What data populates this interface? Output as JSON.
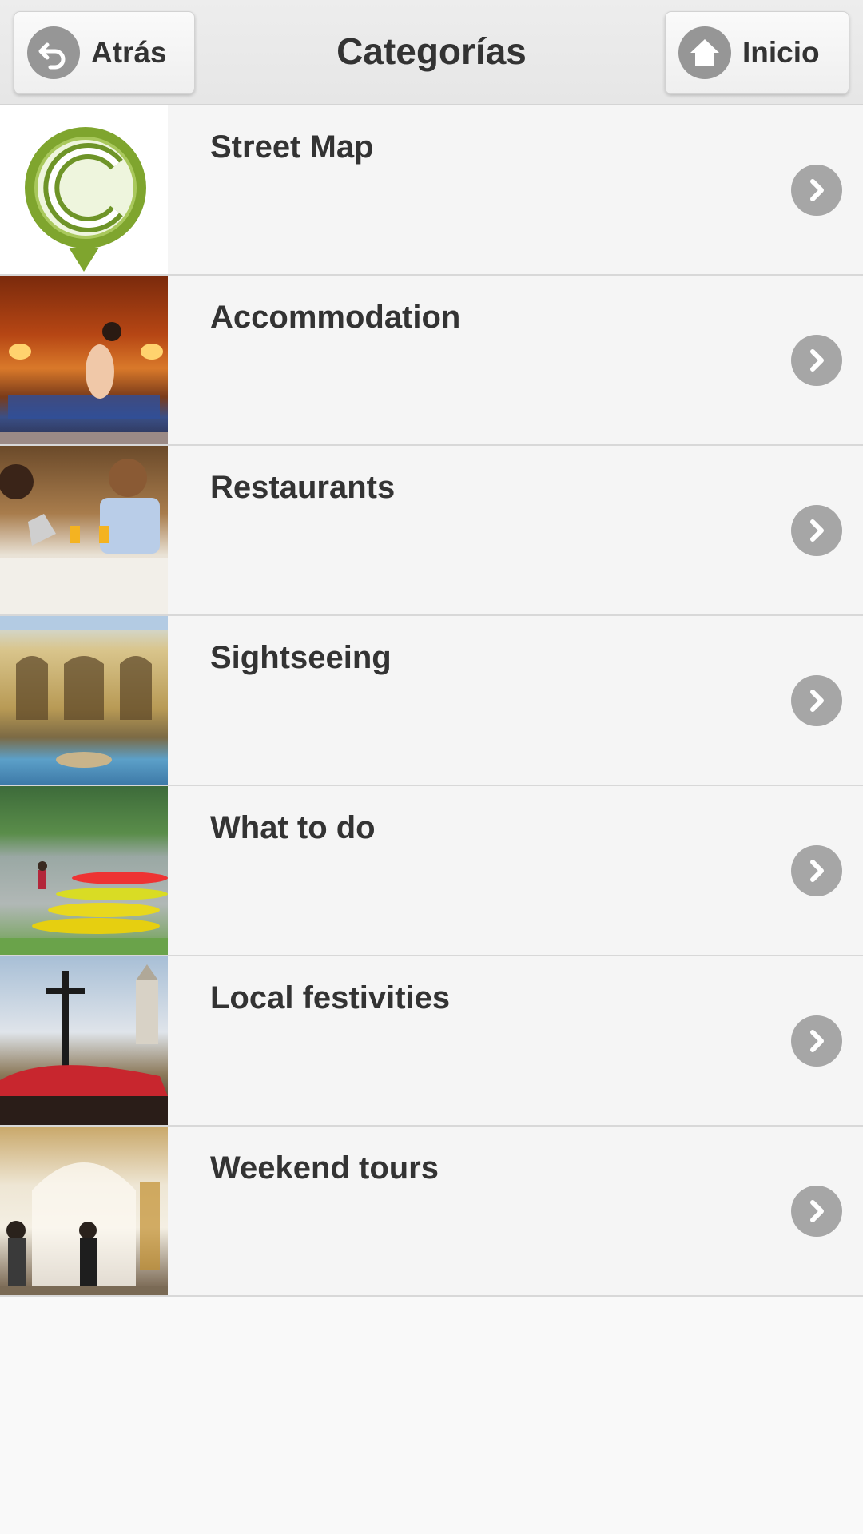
{
  "header": {
    "title": "Categorías",
    "back_label": "Atrás",
    "home_label": "Inicio"
  },
  "categories": [
    {
      "label": "Street Map",
      "thumb": "map-pin-logo"
    },
    {
      "label": "Accommodation",
      "thumb": "hotel-room-photo"
    },
    {
      "label": "Restaurants",
      "thumb": "restaurant-dinner-photo"
    },
    {
      "label": "Sightseeing",
      "thumb": "palace-courtyard-photo"
    },
    {
      "label": "What to do",
      "thumb": "river-kayaks-photo"
    },
    {
      "label": "Local festivities",
      "thumb": "religious-procession-photo"
    },
    {
      "label": "Weekend tours",
      "thumb": "church-interior-photo"
    }
  ],
  "colors": {
    "header_bg": "#e8e8e8",
    "row_bg": "#f5f5f5",
    "chevron_bg": "#a6a6a6",
    "logo_green": "#7fa52e",
    "text": "#333333"
  }
}
